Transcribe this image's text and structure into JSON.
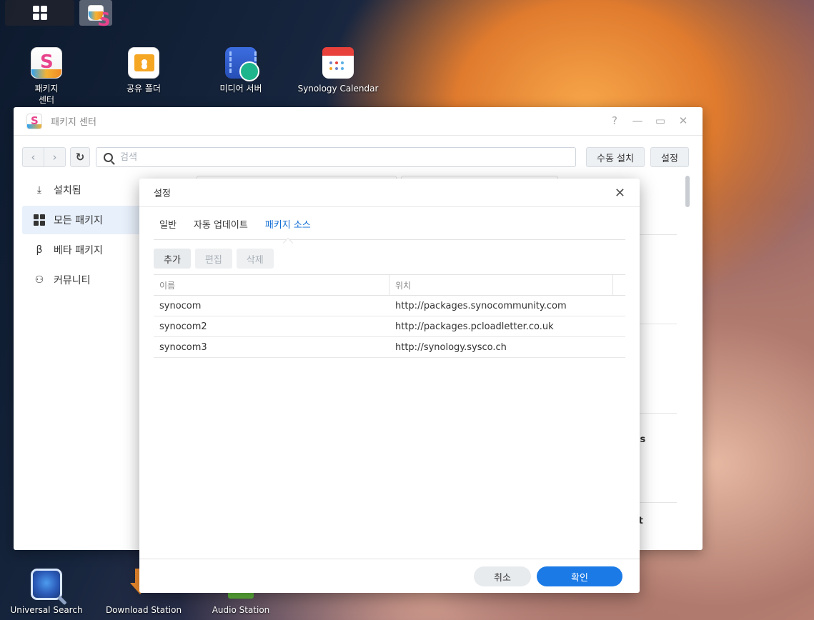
{
  "desktop": {
    "icons_top": [
      {
        "label": "패키지\n센터",
        "icon": "package-center-icon"
      },
      {
        "label": "공유 폴더",
        "icon": "shared-folder-icon"
      },
      {
        "label": "미디어 서버",
        "icon": "media-server-icon"
      },
      {
        "label": "Synology Calendar",
        "icon": "calendar-icon"
      }
    ],
    "icons_bottom": [
      {
        "label": "Universal Search",
        "icon": "universal-search-icon"
      },
      {
        "label": "Download Station",
        "icon": "download-station-icon"
      },
      {
        "label": "Audio Station",
        "icon": "audio-station-icon"
      }
    ],
    "top_label_1a": "패키지",
    "top_label_1b": "센터"
  },
  "window": {
    "title": "패키지 센터",
    "controls": {
      "help": "?",
      "minimize": "—",
      "maximize": "▭",
      "close": "✕"
    },
    "search": {
      "placeholder": "검색",
      "value": ""
    },
    "toolbar": {
      "manual_install": "수동 설치",
      "settings": "설정"
    },
    "sidebar": [
      {
        "label": "설치됨",
        "icon": "download-icon",
        "active": false
      },
      {
        "label": "모든 패키지",
        "icon": "grid-icon",
        "active": true
      },
      {
        "label": "베타 패키지",
        "icon": "beta-icon",
        "active": false
      },
      {
        "label": "커뮤니티",
        "icon": "community-icon",
        "active": false
      }
    ],
    "partial_text_1": "ess",
    "partial_text_2": "oft"
  },
  "dialog": {
    "title": "설정",
    "tabs": [
      {
        "label": "일반",
        "active": false
      },
      {
        "label": "자동 업데이트",
        "active": false
      },
      {
        "label": "패키지 소스",
        "active": true
      }
    ],
    "actions": {
      "add": "추가",
      "edit": "편집",
      "delete": "삭제"
    },
    "table": {
      "headers": [
        "이름",
        "위치"
      ],
      "rows": [
        {
          "name": "synocom",
          "location": "http://packages.synocommunity.com"
        },
        {
          "name": "synocom2",
          "location": "http://packages.pcloadletter.co.uk"
        },
        {
          "name": "synocom3",
          "location": "http://synology.sysco.ch"
        }
      ]
    },
    "footer": {
      "cancel": "취소",
      "ok": "확인"
    }
  },
  "colors": {
    "accent": "#1b7ae6",
    "active_tab": "#0d6bd3",
    "sidebar_active": "#e8f0fb"
  }
}
